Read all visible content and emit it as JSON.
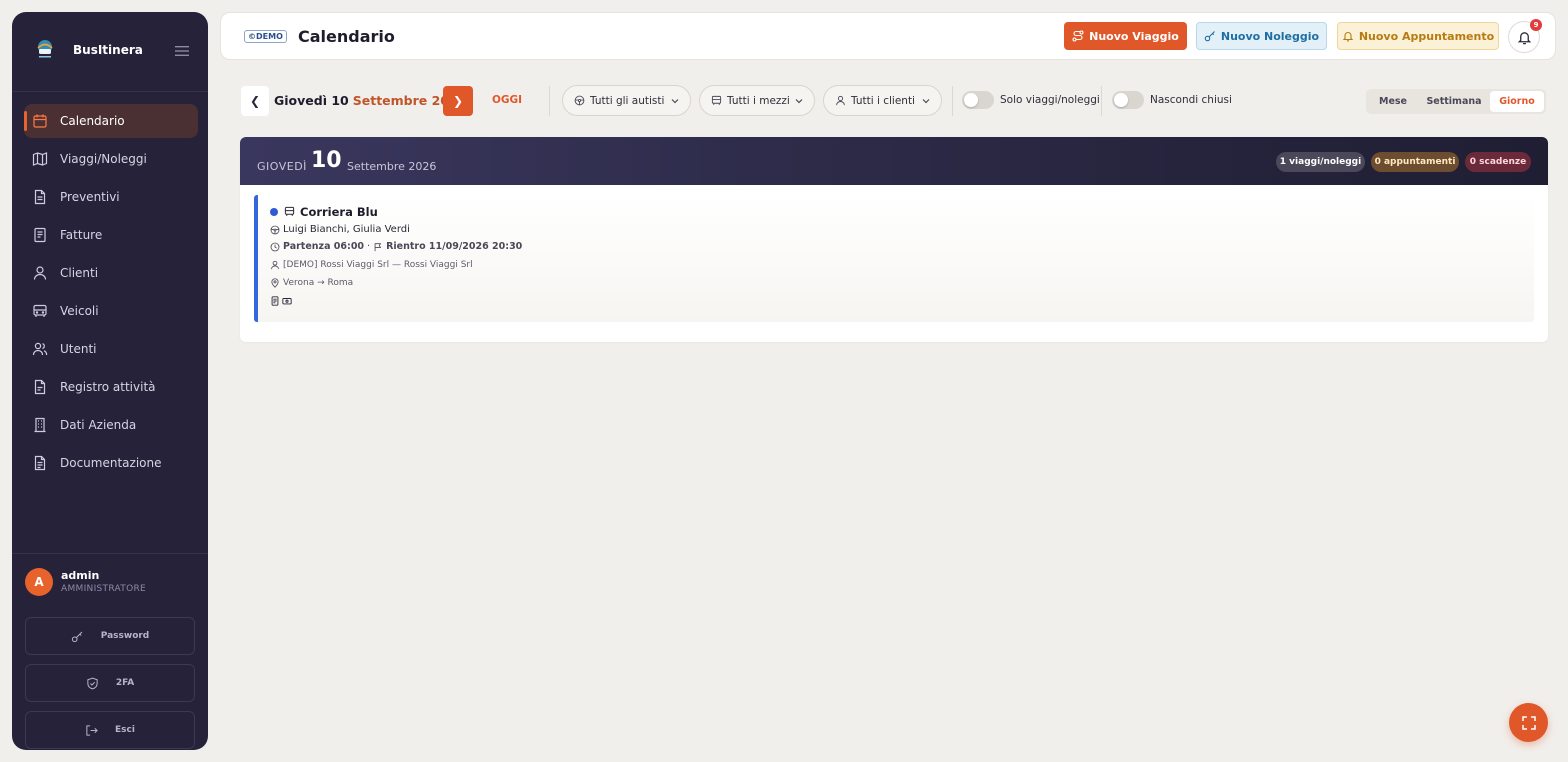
{
  "brand": {
    "name": "BusItinera"
  },
  "sidebar": {
    "items": [
      {
        "label": "Calendario",
        "icon": "calendar-icon",
        "active": true
      },
      {
        "label": "Viaggi/Noleggi",
        "icon": "map-icon"
      },
      {
        "label": "Preventivi",
        "icon": "document-icon"
      },
      {
        "label": "Fatture",
        "icon": "receipt-icon"
      },
      {
        "label": "Clienti",
        "icon": "user-icon"
      },
      {
        "label": "Veicoli",
        "icon": "bus-icon"
      },
      {
        "label": "Utenti",
        "icon": "users-icon"
      },
      {
        "label": "Registro attività",
        "icon": "log-icon"
      },
      {
        "label": "Dati Azienda",
        "icon": "building-icon"
      },
      {
        "label": "Documentazione",
        "icon": "docs-icon"
      }
    ]
  },
  "user": {
    "initial": "A",
    "name": "admin",
    "role": "AMMINISTRATORE",
    "password_label": "Password",
    "twofa_label": "2FA",
    "logout_label": "Esci"
  },
  "header": {
    "demo_badge": "DEMO",
    "title": "Calendario",
    "new_trip": "Nuovo Viaggio",
    "new_rental": "Nuovo Noleggio",
    "new_appointment": "Nuovo Appuntamento",
    "notification_count": "9"
  },
  "toolbar": {
    "prev": "❮",
    "next": "❯",
    "date_weekday": "Giovedì 10",
    "date_rest": "Settembre 2026",
    "today": "OGGI",
    "filter_drivers": "Tutti gli autisti",
    "filter_vehicles": "Tutti i mezzi",
    "filter_clients": "Tutti i clienti",
    "toggle_trips_only": "Solo viaggi/noleggi",
    "toggle_hide_closed": "Nascondi chiusi",
    "views": [
      "Mese",
      "Settimana",
      "Giorno"
    ],
    "active_view": "Giorno"
  },
  "day": {
    "weekday": "GIOVEDÌ",
    "number": "10",
    "month_year": "Settembre 2026",
    "count_trips": "1 viaggi/noleggi",
    "count_appointments": "0 appuntamenti",
    "count_deadlines": "0 scadenze"
  },
  "event": {
    "title": "Corriera Blu",
    "drivers": "Luigi Bianchi, Giulia Verdi",
    "departure": "Partenza 06:00",
    "separator": "·",
    "return": "Rientro 11/09/2026 20:30",
    "client": "[DEMO] Rossi Viaggi Srl — Rossi Viaggi Srl",
    "route": "Verona → Roma",
    "accent_color": "#3566dd"
  },
  "colors": {
    "accent": "#e0572a",
    "sidebar_bg": "#25223a",
    "page_bg": "#f1efeb"
  }
}
